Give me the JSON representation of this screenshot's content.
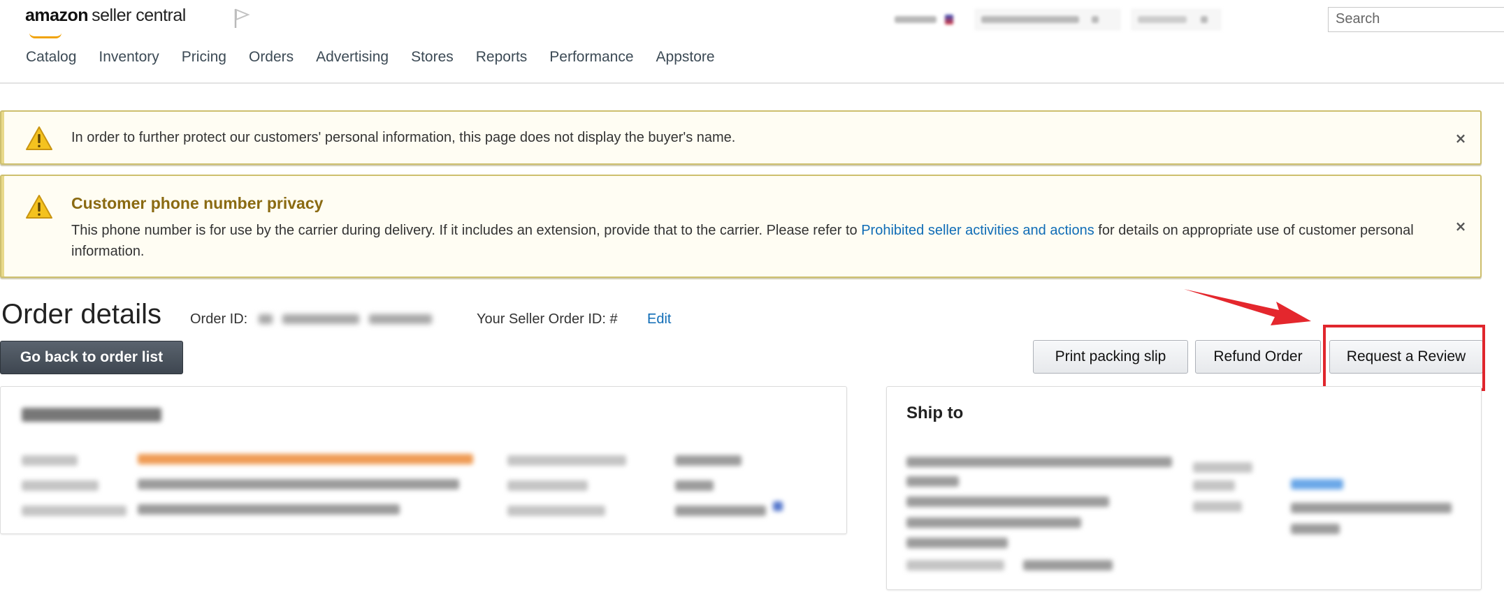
{
  "header": {
    "logo": {
      "brand": "amazon",
      "product": "seller central"
    },
    "icons": {
      "flag": "flag-icon"
    },
    "top_right": {
      "store_selector": "[redacted]",
      "marketplace_selector": "[redacted]",
      "language_selector": "[redacted]"
    },
    "search": {
      "placeholder": "Search"
    },
    "nav": [
      {
        "label": "Catalog"
      },
      {
        "label": "Inventory"
      },
      {
        "label": "Pricing"
      },
      {
        "label": "Orders"
      },
      {
        "label": "Advertising"
      },
      {
        "label": "Stores"
      },
      {
        "label": "Reports"
      },
      {
        "label": "Performance"
      },
      {
        "label": "Appstore"
      }
    ]
  },
  "alerts": [
    {
      "icon": "warning-icon",
      "text": "In order to further protect our customers' personal information, this page does not display the buyer's name.",
      "close_label": "×"
    },
    {
      "icon": "warning-icon",
      "title": "Customer phone number privacy",
      "body_before_link": "This phone number is for use by the carrier during delivery. If it includes an extension, provide that to the carrier. Please refer to ",
      "link_text": "Prohibited seller activities and actions",
      "body_after_link": " for details on appropriate use of customer personal information.",
      "close_label": "×"
    }
  ],
  "order": {
    "title": "Order details",
    "order_id_label": "Order ID:",
    "order_id_value": "[redacted]",
    "seller_order_id_label": "Your Seller Order ID: #",
    "edit_label": "Edit",
    "back_button": "Go back to order list",
    "actions": [
      {
        "label": "Print packing slip"
      },
      {
        "label": "Refund Order"
      },
      {
        "label": "Request a Review",
        "highlighted": true
      }
    ]
  },
  "annotation": {
    "color": "#e0262d",
    "arrow_target": "Request a Review"
  },
  "summary_card": {
    "title": "[redacted]",
    "content": "[redacted]"
  },
  "ship_to_card": {
    "title": "Ship to",
    "content": "[redacted]"
  },
  "colors": {
    "alert_border": "#cdbf6e",
    "alert_bg": "#fffdf3",
    "alert_title": "#8a6a12",
    "link": "#0f6cb6",
    "dark_button": "#3e4650",
    "highlight": "#e0262d"
  }
}
